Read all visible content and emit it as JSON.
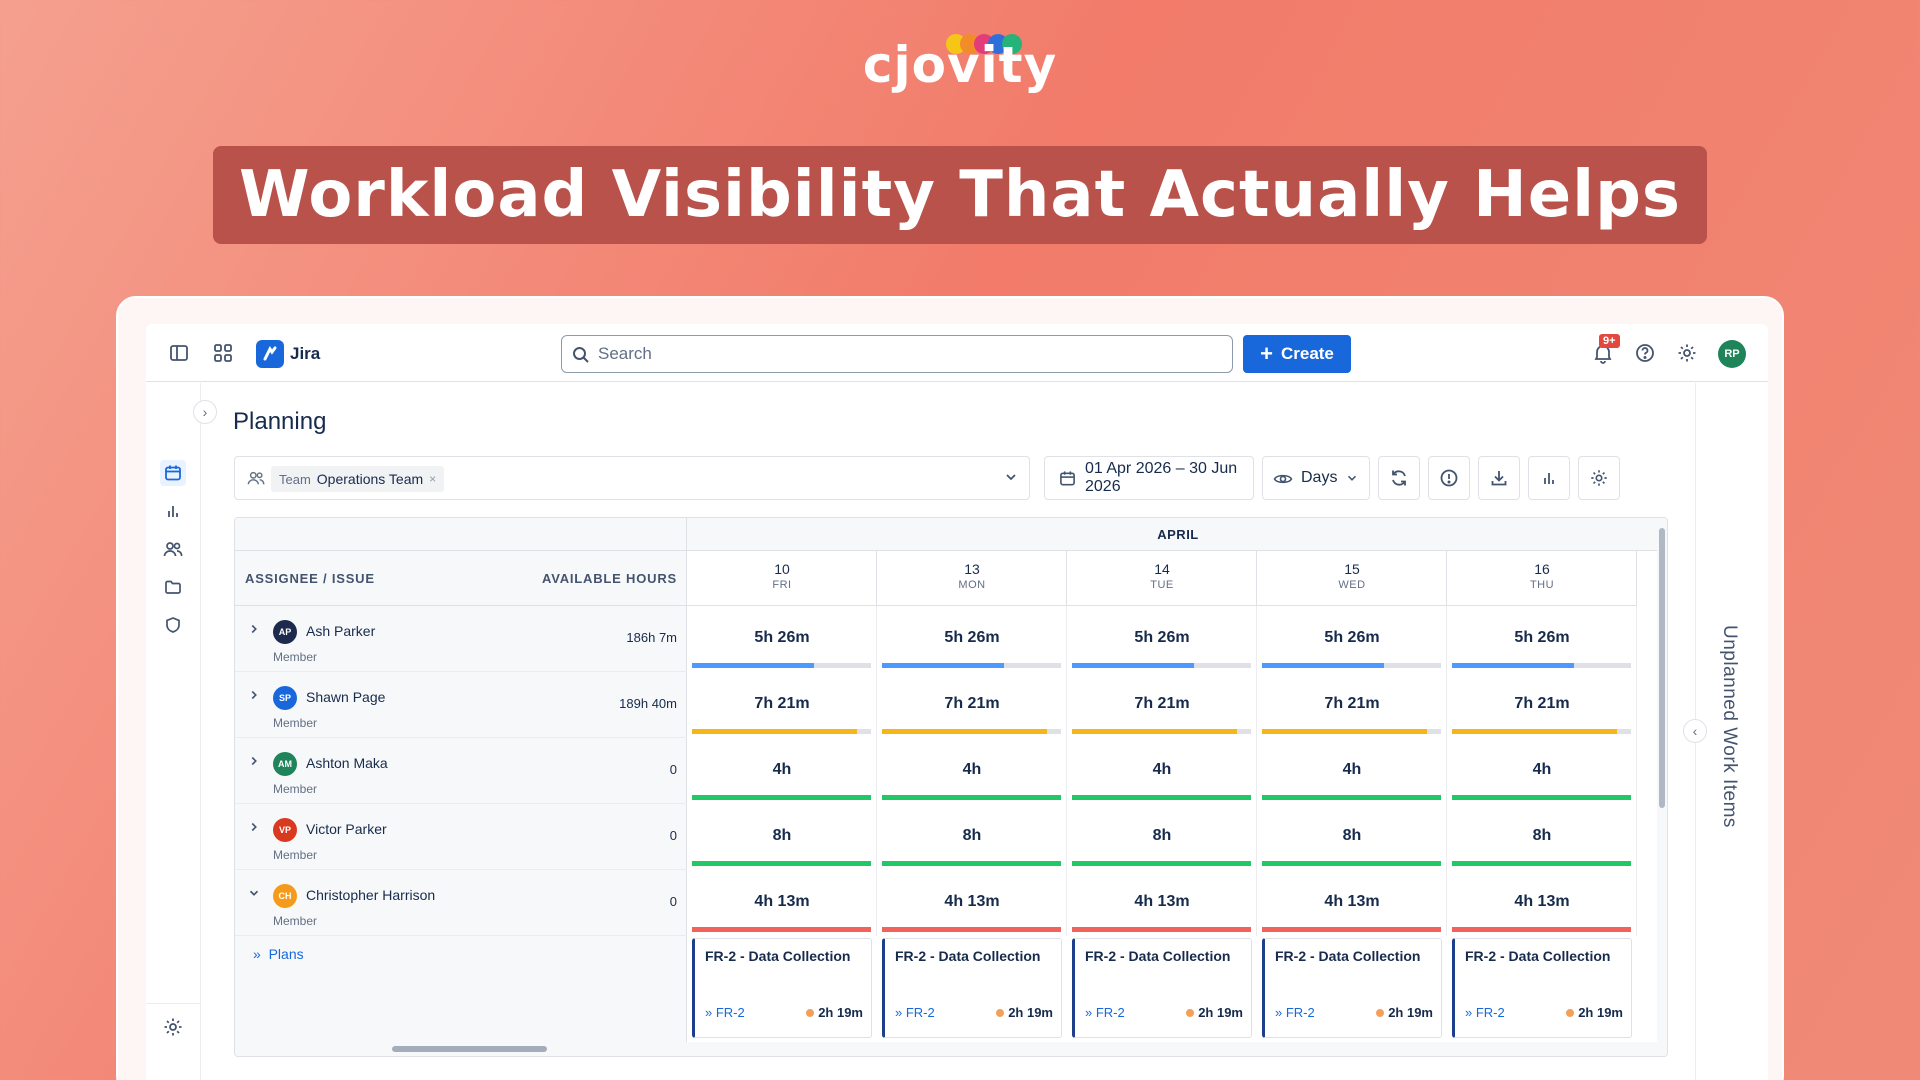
{
  "brand": {
    "name": "cjovity",
    "dot_colors": [
      "#f5c518",
      "#f28c28",
      "#e23c7a",
      "#2f6fdb",
      "#25b37a"
    ]
  },
  "banner": {
    "title": "Workload Visibility That Actually Helps"
  },
  "topnav": {
    "app_name": "Jira",
    "search_placeholder": "Search",
    "create_label": "Create",
    "notifications_badge": "9+",
    "user_initials": "RP"
  },
  "page": {
    "title": "Planning",
    "team_filter": {
      "key": "Team",
      "value": "Operations Team",
      "remove": "×"
    },
    "date_range": "01 Apr 2026 – 30 Jun 2026",
    "view_mode": "Days"
  },
  "grid": {
    "month": "APRIL",
    "col_assignee": "ASSIGNEE / ISSUE",
    "col_hours": "AVAILABLE HOURS",
    "days": [
      {
        "num": "10",
        "dow": "FRI"
      },
      {
        "num": "13",
        "dow": "MON"
      },
      {
        "num": "14",
        "dow": "TUE"
      },
      {
        "num": "15",
        "dow": "WED"
      },
      {
        "num": "16",
        "dow": "THU"
      }
    ],
    "rows": [
      {
        "initials": "AP",
        "name": "Ash Parker",
        "role": "Member",
        "hours": "186h 7m",
        "avatar_color": "#1d2a4d",
        "expanded": false,
        "day_value": "5h 26m",
        "bar_color": "#4c9aff",
        "fill": 0.68
      },
      {
        "initials": "SP",
        "name": "Shawn Page",
        "role": "Member",
        "hours": "189h 40m",
        "avatar_color": "#1868db",
        "expanded": false,
        "day_value": "7h 21m",
        "bar_color": "#f5b617",
        "fill": 0.92
      },
      {
        "initials": "AM",
        "name": "Ashton Maka",
        "role": "Member",
        "hours": "0",
        "avatar_color": "#1f845a",
        "expanded": false,
        "day_value": "4h",
        "bar_color": "#22c766",
        "fill": 1.0
      },
      {
        "initials": "VP",
        "name": "Victor Parker",
        "role": "Member",
        "hours": "0",
        "avatar_color": "#d8391f",
        "expanded": false,
        "day_value": "8h",
        "bar_color": "#22c766",
        "fill": 1.0
      },
      {
        "initials": "CH",
        "name": "Christopher Harrison",
        "role": "Member",
        "hours": "0",
        "avatar_color": "#f59a1b",
        "expanded": true,
        "day_value": "4h 13m",
        "bar_color": "#f0625a",
        "fill": 1.0
      }
    ],
    "plans_label": "Plans",
    "plan_card": {
      "title": "FR-2 - Data Collection",
      "key": "FR-2",
      "hours": "2h 19m"
    }
  },
  "right_panel": {
    "label": "Unplanned Work Items"
  }
}
